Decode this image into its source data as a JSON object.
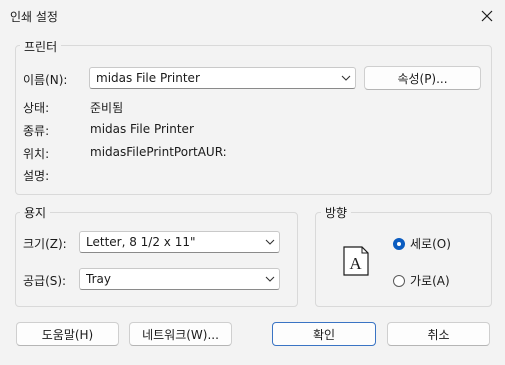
{
  "window": {
    "title": "인쇄 설정"
  },
  "printer": {
    "group_label": "프린터",
    "name_label": "이름(N):",
    "name_value": "midas File Printer",
    "properties_button": "속성(P)...",
    "status_label": "상태:",
    "status_value": "준비됨",
    "type_label": "종류:",
    "type_value": "midas File Printer",
    "where_label": "위치:",
    "where_value": "midasFilePrintPortAUR:",
    "comment_label": "설명:",
    "comment_value": ""
  },
  "paper": {
    "group_label": "용지",
    "size_label": "크기(Z):",
    "size_value": "Letter, 8 1/2 x 11\"",
    "source_label": "공급(S):",
    "source_value": "Tray"
  },
  "orientation": {
    "group_label": "방향",
    "portrait_label": "세로(O)",
    "landscape_label": "가로(A)",
    "selected": "portrait",
    "preview_glyph": "A"
  },
  "buttons": {
    "help": "도움말(H)",
    "network": "네트워크(W)...",
    "ok": "확인",
    "cancel": "취소"
  }
}
